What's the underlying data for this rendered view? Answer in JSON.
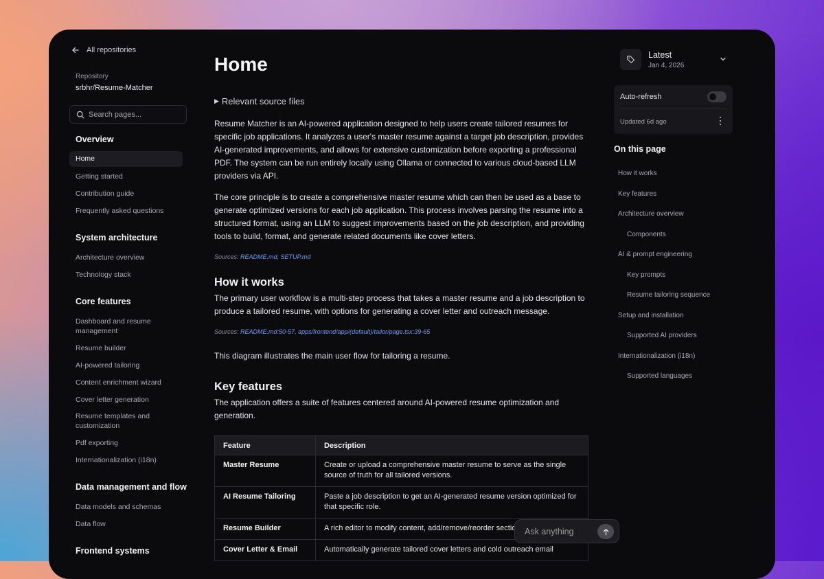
{
  "sidebar": {
    "back_label": "All repositories",
    "repo_label": "Repository",
    "repo_name": "srbhr/Resume-Matcher",
    "search_placeholder": "Search pages...",
    "sections": [
      {
        "title": "Overview",
        "items": [
          "Home",
          "Getting started",
          "Contribution guide",
          "Frequently asked questions"
        ]
      },
      {
        "title": "System architecture",
        "items": [
          "Architecture overview",
          "Technology stack"
        ]
      },
      {
        "title": "Core features",
        "items": [
          "Dashboard and resume management",
          "Resume builder",
          "AI-powered tailoring",
          "Content enrichment wizard",
          "Cover letter generation",
          "Resume templates and customization",
          "Pdf exporting",
          "Internationalization (i18n)"
        ]
      },
      {
        "title": "Data management and flow",
        "items": [
          "Data models and schemas",
          "Data flow"
        ]
      },
      {
        "title": "Frontend systems",
        "items": []
      }
    ]
  },
  "main": {
    "title": "Home",
    "relevant_files": "Relevant source files",
    "intro_p1": "Resume Matcher is an AI-powered application designed to help users create tailored resumes for specific job applications. It analyzes a user's master resume against a target job description, provides AI-generated improvements, and allows for extensive customization before exporting a professional PDF. The system can be run entirely locally using Ollama or connected to various cloud-based LLM providers via API.",
    "intro_p2": "The core principle is to create a comprehensive master resume which can then be used as a base to generate optimized versions for each job application. This process involves parsing the resume into a structured format, using an LLM to suggest improvements based on the job description, and providing tools to build, format, and generate related documents like cover letters.",
    "sources_label": "Sources:",
    "sources1": "README.md, SETUP.md",
    "how_title": "How it works",
    "how_p1": "The primary user workflow is a multi-step process that takes a master resume and a job description to produce a tailored resume, with options for generating a cover letter and outreach message.",
    "sources2": "README.md:50-57, apps/frontend/app/(default)/tailor/page.tsx:39-65",
    "diagram_text": "This diagram illustrates the main user flow for tailoring a resume.",
    "key_title": "Key features",
    "key_p1": "The application offers a suite of features centered around AI-powered resume optimization and generation.",
    "table": {
      "headers": [
        "Feature",
        "Description"
      ],
      "rows": [
        {
          "feature": "Master Resume",
          "description": "Create or upload a comprehensive master resume to serve as the single source of truth for all tailored versions."
        },
        {
          "feature": "AI Resume Tailoring",
          "description": "Paste a job description to get an AI-generated resume version optimized for that specific role."
        },
        {
          "feature": "Resume Builder",
          "description": "A rich editor to modify content, add/remove/reorder sections, and customize."
        },
        {
          "feature": "Cover Letter & Email",
          "description": "Automatically generate tailored cover letters and cold outreach email"
        }
      ]
    },
    "ask_placeholder": "Ask anything"
  },
  "right": {
    "version_title": "Latest",
    "version_date": "Jan 4, 2026",
    "auto_refresh_label": "Auto-refresh",
    "auto_refresh_on": false,
    "updated_label": "Updated 6d ago",
    "toc_title": "On this page",
    "toc": [
      {
        "label": "How it works",
        "level": 1
      },
      {
        "label": "Key features",
        "level": 1
      },
      {
        "label": "Architecture overview",
        "level": 1
      },
      {
        "label": "Components",
        "level": 2
      },
      {
        "label": "AI & prompt engineering",
        "level": 1
      },
      {
        "label": "Key prompts",
        "level": 2
      },
      {
        "label": "Resume tailoring sequence",
        "level": 2
      },
      {
        "label": "Setup and installation",
        "level": 1
      },
      {
        "label": "Supported AI providers",
        "level": 2
      },
      {
        "label": "Internationalization (i18n)",
        "level": 1
      },
      {
        "label": "Supported languages",
        "level": 2
      }
    ]
  },
  "colors": {
    "app_bg": "#0b0b0d",
    "link": "#6d9cf5",
    "active_nav_bg": "#1d1d21"
  },
  "icons": [
    "arrow-left-icon",
    "search-icon",
    "tag-icon",
    "chevron-down-icon",
    "kebab-icon",
    "arrow-up-icon"
  ]
}
